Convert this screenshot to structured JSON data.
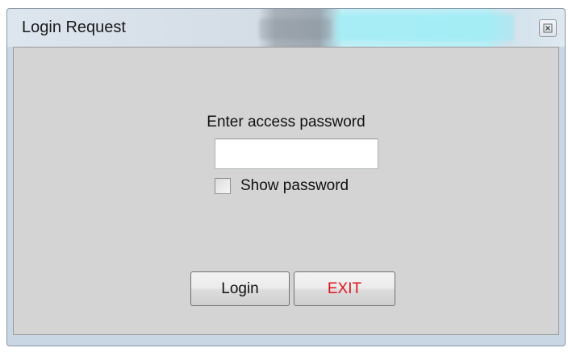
{
  "window": {
    "title": "Login Request",
    "close_icon": "close-icon"
  },
  "form": {
    "prompt": "Enter access password",
    "password_value": "",
    "password_placeholder": "",
    "show_password_label": "Show password",
    "show_password_checked": false
  },
  "buttons": {
    "login_label": "Login",
    "exit_label": "EXIT",
    "exit_color": "#e0141e"
  }
}
